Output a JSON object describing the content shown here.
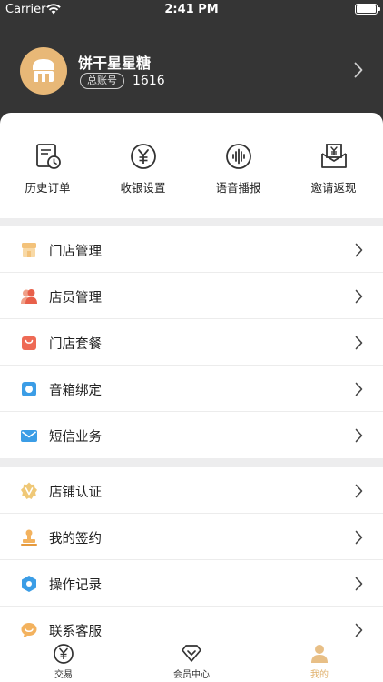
{
  "status_bar": {
    "carrier": "Carrier",
    "time": "2:41 PM"
  },
  "profile": {
    "name": "饼干星星糖",
    "account_badge": "总账号",
    "account_number": "1616"
  },
  "quick_actions": [
    {
      "label": "历史订单",
      "icon": "order-history-icon"
    },
    {
      "label": "收银设置",
      "icon": "yen-circle-icon"
    },
    {
      "label": "语音播报",
      "icon": "voice-wave-icon"
    },
    {
      "label": "邀请返现",
      "icon": "invite-envelope-icon"
    }
  ],
  "menu_group_1": [
    {
      "label": "门店管理",
      "icon": "store-icon"
    },
    {
      "label": "店员管理",
      "icon": "staff-icon"
    },
    {
      "label": "门店套餐",
      "icon": "package-bag-icon"
    },
    {
      "label": "音箱绑定",
      "icon": "speaker-icon"
    },
    {
      "label": "短信业务",
      "icon": "mail-icon"
    }
  ],
  "menu_group_2": [
    {
      "label": "店铺认证",
      "icon": "verified-badge-icon"
    },
    {
      "label": "我的签约",
      "icon": "seal-stamp-icon"
    },
    {
      "label": "操作记录",
      "icon": "hexagon-record-icon"
    },
    {
      "label": "联系客服",
      "icon": "customer-service-icon"
    }
  ],
  "tabs": [
    {
      "label": "交易",
      "icon": "yen-tab-icon",
      "active": false
    },
    {
      "label": "会员中心",
      "icon": "diamond-tab-icon",
      "active": false
    },
    {
      "label": "我的",
      "icon": "person-tab-icon",
      "active": true
    }
  ],
  "colors": {
    "header_bg": "#353535",
    "accent": "#e0b06b"
  }
}
